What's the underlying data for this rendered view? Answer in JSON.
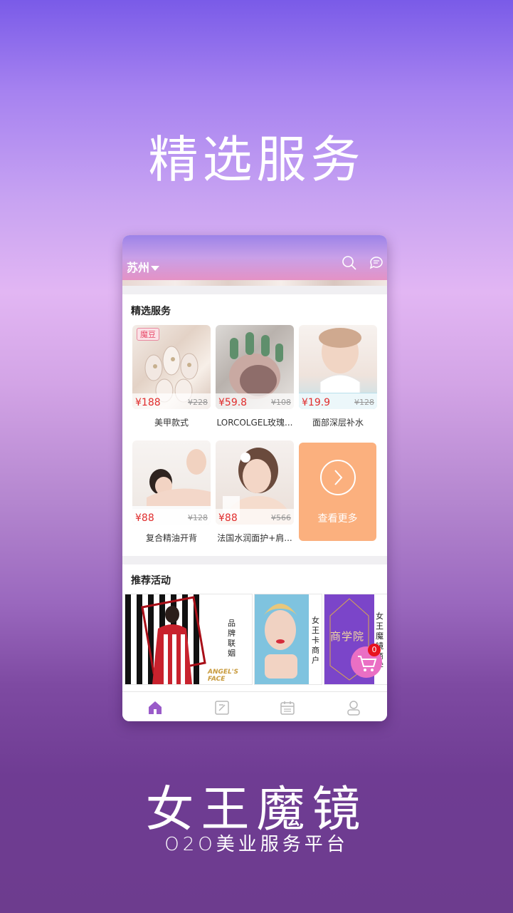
{
  "hero": {
    "title": "精选服务"
  },
  "brand": {
    "title": "女王魔镜",
    "subtitle": "O2O美业服务平台"
  },
  "header": {
    "city": "苏州"
  },
  "featured": {
    "title": "精选服务",
    "items": [
      {
        "badge": "魔豆",
        "price": "¥188",
        "old_price": "¥228",
        "name": "美甲款式"
      },
      {
        "badge": "",
        "price": "¥59.8",
        "old_price": "¥108",
        "name": "LORCOLGEL玫瑰..."
      },
      {
        "badge": "",
        "price": "¥19.9",
        "old_price": "¥128",
        "name": "面部深层补水"
      },
      {
        "badge": "",
        "price": "¥88",
        "old_price": "¥128",
        "name": "复合精油开背"
      },
      {
        "badge": "",
        "price": "¥88",
        "old_price": "¥566",
        "name": "法国水润面护+肩..."
      }
    ],
    "more_label": "查看更多"
  },
  "activities": {
    "title": "推荐活动",
    "items": [
      {
        "vertical_text": "品牌联姻",
        "caption": "ANGEL'S FACE"
      },
      {
        "vertical_text": "女王卡商户"
      },
      {
        "vertical_text": "女王魔镜商学",
        "inner_text": "商学院"
      }
    ]
  },
  "cart": {
    "count": "0"
  },
  "colors": {
    "accent": "#e02d2d",
    "more": "#fbb07e",
    "cart": "#ea6fc4"
  },
  "tabs": [
    "home-icon",
    "discover-icon",
    "calendar-icon",
    "profile-icon"
  ]
}
